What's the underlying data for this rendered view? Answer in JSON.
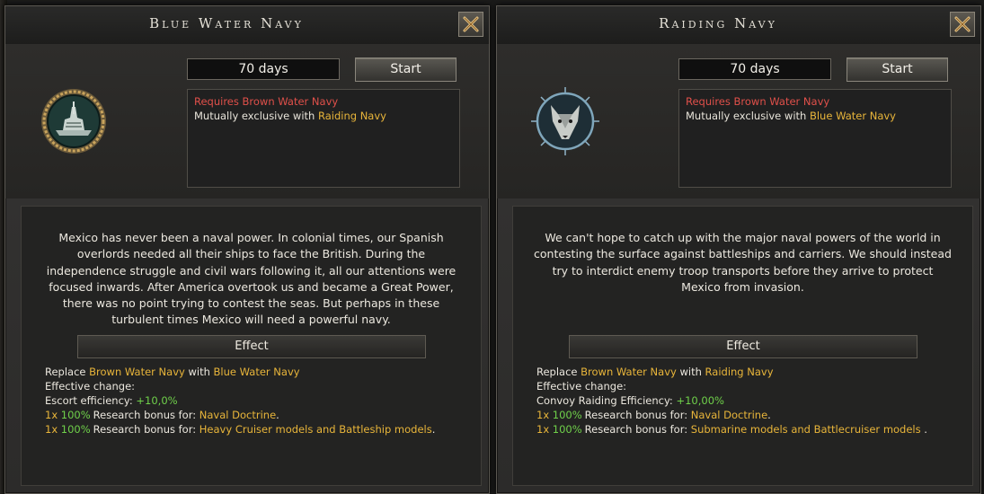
{
  "colors": {
    "requirement": "#e0504a",
    "highlight": "#e8b53a",
    "positive": "#6fd04a"
  },
  "left": {
    "title": "Blue Water Navy",
    "emblem_icon": "battleship-emblem-icon",
    "duration": "70 days",
    "start_label": "Start",
    "req_prefix": "Requires",
    "req_name": "Brown Water Navy",
    "excl_prefix": "Mutually exclusive with",
    "excl_name": "Raiding Navy",
    "description": "Mexico has never been a naval power. In colonial times, our Spanish overlords needed all their ships to face the British. During the independence struggle and civil wars following it, all our attentions were focused inwards. After America overtook us and became a Great Power, there was no point trying to contest the seas. But perhaps in these turbulent times Mexico will need a powerful navy.",
    "effect_header": "Effect",
    "replace_word": "Replace",
    "replace_from": "Brown Water Navy",
    "with_word": "with",
    "replace_to": "Blue Water Navy",
    "effective_change": "Effective change:",
    "stat_label": "Escort efficiency:",
    "stat_value": "+10,0%",
    "bonus1_mult": "1x",
    "bonus1_pct": "100%",
    "bonus1_text": "Research bonus for:",
    "bonus1_target": "Naval Doctrine",
    "bonus1_end": ".",
    "bonus2_mult": "1x",
    "bonus2_pct": "100%",
    "bonus2_text": "Research bonus for:",
    "bonus2_target": "Heavy Cruiser models and Battleship models",
    "bonus2_end": "."
  },
  "right": {
    "title": "Raiding Navy",
    "emblem_icon": "wolf-emblem-icon",
    "duration": "70 days",
    "start_label": "Start",
    "req_prefix": "Requires",
    "req_name": "Brown Water Navy",
    "excl_prefix": "Mutually exclusive with",
    "excl_name": "Blue Water Navy",
    "description": "We can't hope to catch up with the major naval powers of the world in contesting the surface against battleships and carriers. We should instead try to interdict enemy troop transports before they arrive to protect Mexico from invasion.",
    "effect_header": "Effect",
    "replace_word": "Replace",
    "replace_from": "Brown Water Navy",
    "with_word": "with",
    "replace_to": "Raiding Navy",
    "effective_change": "Effective change:",
    "stat_label": "Convoy Raiding Efficiency:",
    "stat_value": "+10,00%",
    "bonus1_mult": "1x",
    "bonus1_pct": "100%",
    "bonus1_text": "Research bonus for:",
    "bonus1_target": "Naval Doctrine",
    "bonus1_end": ".",
    "bonus2_mult": "1x",
    "bonus2_pct": "100%",
    "bonus2_text": "Research bonus for:",
    "bonus2_target": "Submarine models and Battlecruiser models",
    "bonus2_end": " ."
  }
}
